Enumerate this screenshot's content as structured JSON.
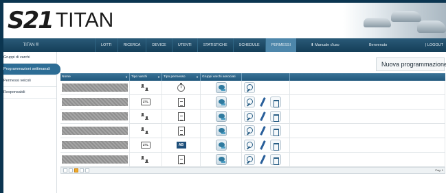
{
  "brand": {
    "mark": "S21",
    "name": "TITAN"
  },
  "navbar": {
    "app_label": "TITAN ®",
    "items": [
      {
        "label": "LOTTI",
        "active": false
      },
      {
        "label": "RICERCA",
        "active": false
      },
      {
        "label": "DEVICE",
        "active": false
      },
      {
        "label": "UTENTI",
        "active": false
      },
      {
        "label": "STATISTICHE",
        "active": false
      },
      {
        "label": "SCHEDULE",
        "active": false
      },
      {
        "label": "PERMESSI",
        "active": true
      }
    ],
    "manual": "Manuale d'uso",
    "welcome": "Benvenuto",
    "logout": "| LOGOUT"
  },
  "sidebar": {
    "items": [
      {
        "label": "Gruppi di varchi",
        "active": false
      },
      {
        "label": "Programmazioni settimanali",
        "active": true
      },
      {
        "label": "Permessi veicoli",
        "active": false
      },
      {
        "label": "Responsabili",
        "active": false
      }
    ]
  },
  "toolbar": {
    "new_label": "Nuova programmazione"
  },
  "table": {
    "columns": [
      "Nome",
      "Tipo varchi",
      "Tipo permesso",
      "Gruppi varchi associati"
    ],
    "sort_marker": "▼",
    "rows": [
      {
        "varco": "gate-icon",
        "permesso": "clock-icon",
        "actions": [
          "search-icon"
        ]
      },
      {
        "varco": "ztl-icon",
        "permesso": "document-icon",
        "actions": [
          "search-icon",
          "pencil-icon",
          "trash-icon"
        ]
      },
      {
        "varco": "gate-icon",
        "permesso": "document-icon",
        "actions": [
          "search-icon",
          "pencil-icon",
          "trash-icon"
        ]
      },
      {
        "varco": "gate-icon",
        "permesso": "document-icon",
        "actions": [
          "search-icon",
          "pencil-icon",
          "trash-icon"
        ]
      },
      {
        "varco": "ztl-icon",
        "permesso": "ab-icon",
        "actions": [
          "search-icon",
          "pencil-icon",
          "trash-icon"
        ]
      },
      {
        "varco": "gate-icon",
        "permesso": "document-icon",
        "actions": [
          "search-icon",
          "pencil-icon",
          "trash-icon"
        ]
      }
    ],
    "ztl_text": "ZTL",
    "ab_text": "AB"
  },
  "pager": {
    "page_size_label": "Pag: 1"
  },
  "colors": {
    "nav": "#1f5070",
    "active": "#2d6d95",
    "accent": "#f0a92a"
  }
}
